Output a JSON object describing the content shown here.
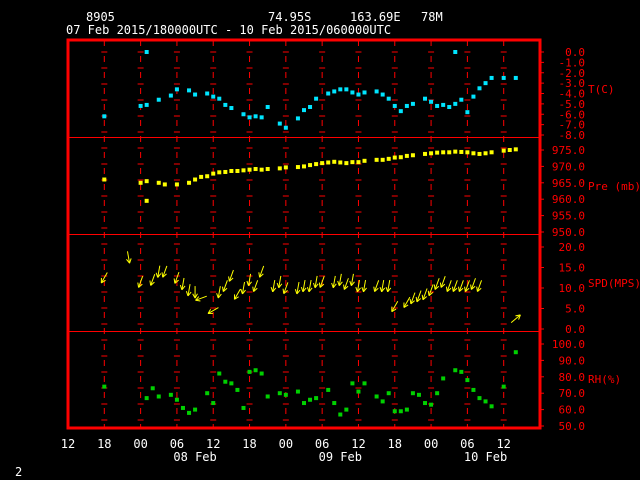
{
  "header": {
    "station": "8905",
    "lat": "74.95S",
    "lon": "163.69E",
    "elev": "78M",
    "period": "07 Feb 2015/180000UTC - 10 Feb 2015/060000UTC"
  },
  "footer": {
    "page": "2"
  },
  "colors": {
    "frame": "#ff0000",
    "temp": "#00e5ff",
    "pres": "#ffff00",
    "wind": "#ffff00",
    "rh": "#00d000",
    "axis_text": "#ffffff"
  },
  "chart_data": [
    {
      "type": "scatter",
      "name": "T(C)",
      "ylabel": "T(C)",
      "ylim": [
        -8.0,
        0.0
      ],
      "yticks": [
        "0.0",
        "-1.0",
        "-2.0",
        "-3.0",
        "-4.0",
        "-5.0",
        "-6.0",
        "-7.0",
        "-8.0"
      ],
      "ytick_values": [
        0,
        -1,
        -2,
        -3,
        -4,
        -5,
        -6,
        -7,
        -8
      ],
      "x": [
        18,
        24,
        25,
        27,
        29,
        30,
        32,
        33,
        35,
        36,
        37,
        38,
        39,
        41,
        42,
        43,
        44,
        45,
        47,
        48,
        50,
        51,
        52,
        53,
        55,
        56,
        57,
        58,
        59,
        60,
        61,
        63,
        64,
        65,
        66,
        67,
        68,
        69,
        71,
        72,
        73,
        74,
        75,
        76,
        77,
        78,
        79,
        80
      ],
      "values": [
        -6.2,
        -5.2,
        -5.1,
        -4.6,
        -4.2,
        -3.6,
        -3.7,
        -4.1,
        -4.0,
        -4.3,
        -4.5,
        -5.1,
        -5.4,
        -6.0,
        -6.3,
        -6.2,
        -6.3,
        -5.3,
        -6.9,
        -7.3,
        -6.4,
        -5.6,
        -5.3,
        -4.5,
        -4.0,
        -3.8,
        -3.6,
        -3.6,
        -3.9,
        -4.1,
        -3.9,
        -3.8,
        -4.1,
        -4.5,
        -5.2,
        -5.7,
        -5.2,
        -5.0,
        -4.5,
        -4.8,
        -5.2,
        -5.1,
        -5.3,
        -5.0,
        -4.6,
        -5.8,
        -4.3,
        -3.5
      ],
      "x_extra": [
        25,
        76,
        81,
        82,
        84,
        86
      ],
      "values_extra": [
        0.0,
        0.0,
        -3.0,
        -2.5,
        -2.5,
        -2.5
      ]
    },
    {
      "type": "scatter",
      "name": "Pre (mb)",
      "ylabel": "Pre (mb)",
      "ylim": [
        950.0,
        975.0
      ],
      "yticks": [
        "975.0",
        "970.0",
        "965.0",
        "960.0",
        "955.0",
        "950.0"
      ],
      "ytick_values": [
        975,
        970,
        965,
        960,
        955,
        950
      ],
      "x": [
        18,
        24,
        25,
        27,
        28,
        30,
        32,
        33,
        34,
        35,
        36,
        37,
        38,
        39,
        40,
        41,
        42,
        43,
        44,
        45,
        47,
        48,
        50,
        51,
        52,
        53,
        54,
        55,
        56,
        57,
        58,
        59,
        60,
        61,
        63,
        64,
        65,
        66,
        67,
        68,
        69,
        71,
        72,
        73,
        74,
        75,
        76,
        77,
        78,
        79,
        80,
        81,
        82,
        84,
        85,
        86
      ],
      "values": [
        966.0,
        965.0,
        965.5,
        965.0,
        964.5,
        964.5,
        965.0,
        966.0,
        966.8,
        967.0,
        967.8,
        968.2,
        968.3,
        968.6,
        968.6,
        968.8,
        969.0,
        969.2,
        969.0,
        969.2,
        969.4,
        969.7,
        969.8,
        970.0,
        970.4,
        970.7,
        971.0,
        971.2,
        971.4,
        971.2,
        971.0,
        971.3,
        971.3,
        971.7,
        972.0,
        972.0,
        972.3,
        972.7,
        972.8,
        973.2,
        973.4,
        973.8,
        974.0,
        974.2,
        974.3,
        974.3,
        974.5,
        974.4,
        974.3,
        974.0,
        973.8,
        974.0,
        974.3,
        974.8,
        975.0,
        975.2
      ],
      "x_extra": [
        25
      ],
      "values_extra": [
        959.5
      ]
    },
    {
      "type": "scatter",
      "name": "SPD(MPS)",
      "ylabel": "SPD(MPS)",
      "ylim": [
        0.0,
        20.0
      ],
      "yticks": [
        "20.0",
        "15.0",
        "10.0",
        "5.0",
        "0.0"
      ],
      "ytick_values": [
        20,
        15,
        10,
        5,
        0
      ],
      "x": [
        18,
        22,
        24,
        26,
        27,
        28,
        30,
        31,
        32,
        33,
        34,
        36,
        37,
        38,
        39,
        40,
        41,
        42,
        43,
        44,
        46,
        47,
        48,
        50,
        51,
        52,
        53,
        54,
        56,
        57,
        58,
        59,
        60,
        61,
        63,
        64,
        65,
        66,
        68,
        69,
        70,
        71,
        72,
        73,
        74,
        75,
        76,
        77,
        78,
        79,
        80,
        86
      ],
      "values": [
        12.5,
        17.5,
        11.5,
        12.0,
        14.0,
        14.0,
        12.5,
        11.0,
        9.5,
        9.0,
        7.5,
        4.5,
        9.0,
        10.5,
        13.0,
        8.5,
        10.0,
        12.0,
        10.5,
        14.0,
        10.5,
        11.5,
        10.0,
        10.0,
        10.5,
        10.5,
        11.5,
        11.5,
        11.5,
        12.0,
        11.0,
        12.0,
        10.5,
        10.5,
        10.5,
        10.5,
        10.5,
        5.5,
        6.5,
        7.5,
        8.0,
        8.5,
        9.5,
        11.0,
        11.5,
        10.5,
        10.5,
        10.5,
        10.5,
        11.0,
        10.5,
        2.5
      ],
      "dir": [
        240,
        280,
        250,
        250,
        260,
        250,
        250,
        260,
        260,
        270,
        200,
        210,
        260,
        250,
        250,
        240,
        260,
        260,
        250,
        250,
        260,
        260,
        250,
        260,
        260,
        260,
        260,
        250,
        260,
        260,
        250,
        260,
        260,
        260,
        250,
        260,
        260,
        240,
        240,
        250,
        250,
        250,
        250,
        250,
        250,
        250,
        250,
        250,
        250,
        250,
        250,
        40
      ]
    },
    {
      "type": "scatter",
      "name": "RH(%)",
      "ylabel": "RH(%)",
      "ylim": [
        50.0,
        100.0
      ],
      "yticks": [
        "100.0",
        "90.0",
        "80.0",
        "70.0",
        "60.0",
        "50.0"
      ],
      "ytick_values": [
        100,
        90,
        80,
        70,
        60,
        50
      ],
      "x": [
        18,
        25,
        26,
        27,
        29,
        30,
        31,
        32,
        33,
        35,
        36,
        37,
        38,
        39,
        40,
        41,
        42,
        43,
        44,
        45,
        47,
        48,
        50,
        51,
        52,
        53,
        55,
        56,
        57,
        58,
        59,
        60,
        61,
        63,
        64,
        65,
        66,
        67,
        68,
        69,
        70,
        71,
        72,
        73,
        74,
        76,
        77,
        78,
        79,
        80,
        81,
        82,
        84,
        86
      ],
      "values": [
        74.0,
        67.0,
        73.0,
        68.0,
        69.0,
        66.0,
        61.0,
        58.0,
        60.0,
        70.0,
        64.0,
        82.0,
        77.0,
        76.0,
        72.0,
        61.0,
        83.0,
        84.0,
        82.0,
        68.0,
        70.0,
        69.0,
        71.0,
        64.0,
        66.0,
        67.0,
        72.0,
        64.0,
        57.0,
        60.0,
        76.0,
        71.0,
        76.0,
        68.0,
        65.0,
        70.0,
        59.0,
        59.0,
        60.0,
        70.0,
        69.0,
        64.0,
        63.0,
        70.0,
        79.0,
        84.0,
        83.0,
        78.0,
        72.0,
        67.0,
        65.0,
        62.0,
        74.0,
        95.0
      ]
    }
  ],
  "x_axis": {
    "hour_labels": [
      "12",
      "18",
      "00",
      "06",
      "12",
      "18",
      "00",
      "06",
      "12",
      "18",
      "00",
      "06",
      "12"
    ],
    "date_labels": [
      "08 Feb",
      "09 Feb",
      "10 Feb"
    ]
  }
}
